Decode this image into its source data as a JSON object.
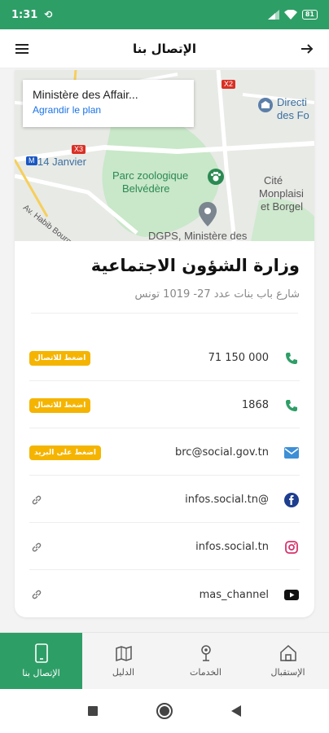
{
  "status_bar": {
    "time": "1:31",
    "battery": "81"
  },
  "app_bar": {
    "title": "الإتصال بنا"
  },
  "map": {
    "popup_title": "Ministère des Affair...",
    "popup_link": "Agrandir le plan",
    "labels": {
      "directi": "Directi",
      "des_fo": "des Fo",
      "januar": "14 Janvier",
      "metro": "M",
      "x2": "X2",
      "x3": "X3",
      "parc": "Parc zoologique",
      "belvedere": "Belvédère",
      "cite": "Cité",
      "monplaisi": "Monplaisi",
      "borgel": "et Borgel",
      "habib": "Av. Habib Bourguiba",
      "dgps": "DGPS, Ministère des"
    }
  },
  "org": {
    "title": "وزارة الشؤون الاجتماعية",
    "address": "شارع باب بنات عدد 27- 1019 تونس"
  },
  "contacts": [
    {
      "value": "71 150 000",
      "action": "اضغط للاتصال",
      "icon": "phone-icon"
    },
    {
      "value": "1868",
      "action": "اضغط للاتصال",
      "icon": "phone-icon"
    },
    {
      "value": "brc@social.gov.tn",
      "action": "اضغط على البريد",
      "icon": "mail-icon"
    },
    {
      "value": "infos.social.tn@",
      "icon": "facebook-icon"
    },
    {
      "value": "infos.social.tn",
      "icon": "instagram-icon"
    },
    {
      "value": "mas_channel",
      "icon": "youtube-icon"
    }
  ],
  "bottom_nav": {
    "contact": "الإتصال بنا",
    "guide": "الدليل",
    "services": "الخدمات",
    "home": "الإستقبال"
  },
  "colors": {
    "primary": "#2e9e67",
    "badge": "#f5b400",
    "link": "#1a73e8"
  }
}
